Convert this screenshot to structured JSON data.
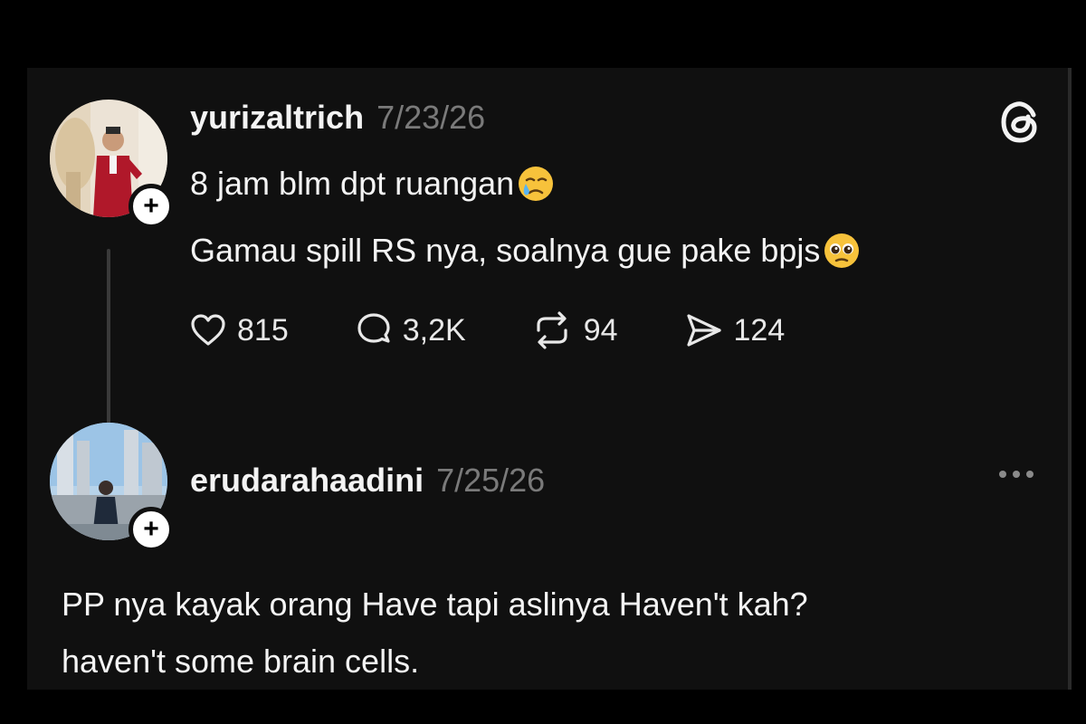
{
  "colors": {
    "background": "#000000",
    "panel": "#101010",
    "text": "#f3f3f3",
    "muted": "#7a7a7a",
    "thread_line": "#3a3a3a"
  },
  "post": {
    "username": "yurizaltrich",
    "timestamp": "7/23/26",
    "line1": "8 jam blm dpt ruangan",
    "line1_emoji": "crying-face-emoji",
    "line2": "Gamau spill RS nya, soalnya gue pake bpjs",
    "line2_emoji": "pleading-face-emoji",
    "avatar_icon": "person-in-red-suit-avatar",
    "follow_icon": "plus-icon",
    "brand_icon": "threads-logo-icon",
    "actions": {
      "likes": "815",
      "replies": "3,2K",
      "reposts": "94",
      "shares": "124"
    }
  },
  "reply": {
    "username": "erudarahaadini",
    "timestamp": "7/25/26",
    "avatar_icon": "city-street-avatar",
    "follow_icon": "plus-icon",
    "more_icon": "more-dots-icon",
    "line1": "PP nya kayak orang Have tapi aslinya Haven't kah?",
    "line2": "haven't some brain cells."
  }
}
